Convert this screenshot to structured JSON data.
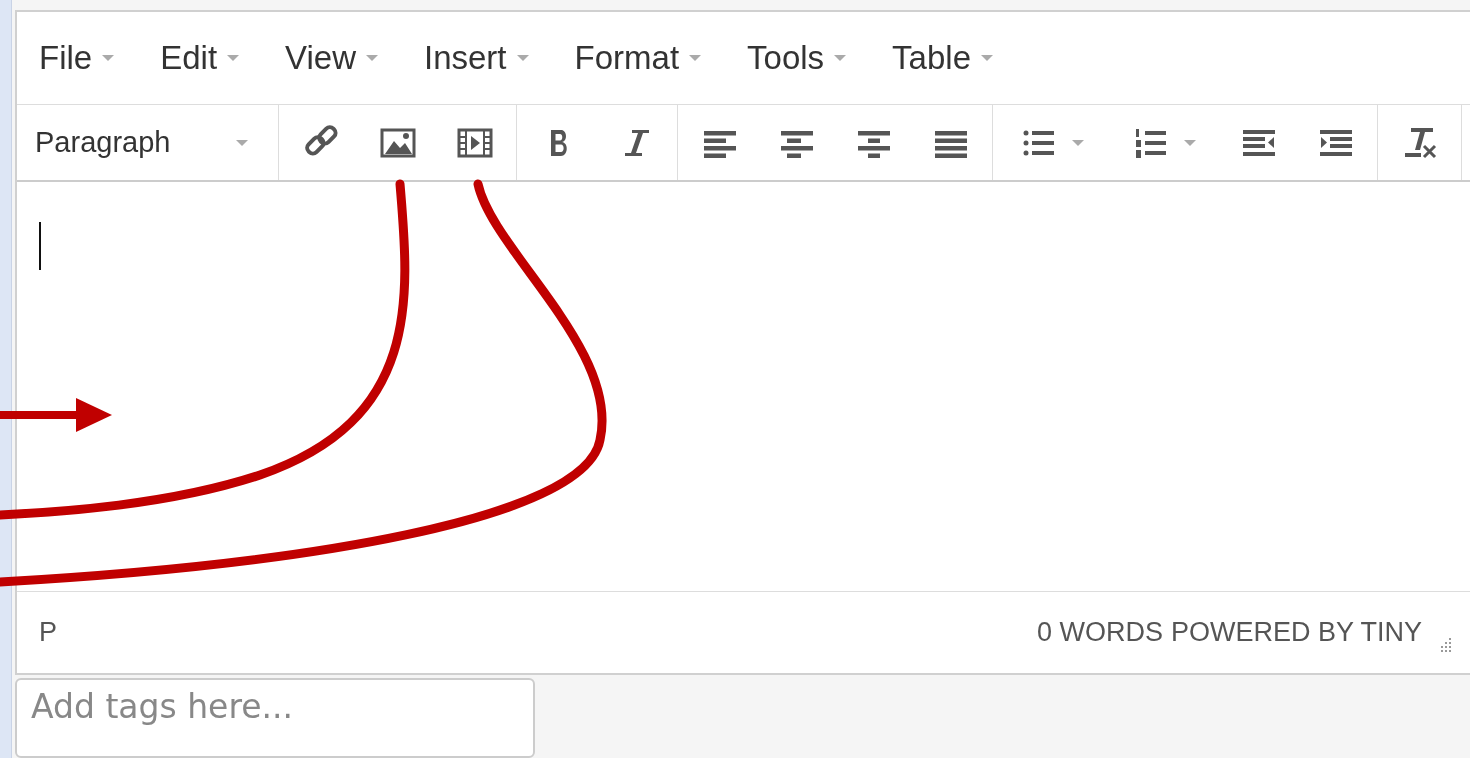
{
  "menubar": [
    {
      "label": "File"
    },
    {
      "label": "Edit"
    },
    {
      "label": "View"
    },
    {
      "label": "Insert"
    },
    {
      "label": "Format"
    },
    {
      "label": "Tools"
    },
    {
      "label": "Table"
    }
  ],
  "toolbar": {
    "format_select": "Paragraph",
    "groups": [
      [
        {
          "kind": "link",
          "has_menu": false
        },
        {
          "kind": "image",
          "has_menu": false
        },
        {
          "kind": "media",
          "has_menu": false
        }
      ],
      [
        {
          "kind": "bold",
          "has_menu": false
        },
        {
          "kind": "italic",
          "has_menu": false
        }
      ],
      [
        {
          "kind": "align-left",
          "has_menu": false
        },
        {
          "kind": "align-center",
          "has_menu": false
        },
        {
          "kind": "align-right",
          "has_menu": false
        },
        {
          "kind": "justify",
          "has_menu": false
        }
      ],
      [
        {
          "kind": "bullet-list",
          "has_menu": true
        },
        {
          "kind": "numbered-list",
          "has_menu": true
        },
        {
          "kind": "outdent",
          "has_menu": false
        },
        {
          "kind": "indent",
          "has_menu": false
        }
      ],
      [
        {
          "kind": "clear-format",
          "has_menu": false
        }
      ]
    ]
  },
  "status_bar": {
    "path": "P",
    "word_count": "0 WORDS",
    "branding": "POWERED BY TINY"
  },
  "tags_field": {
    "placeholder": "Add tags here..."
  },
  "annotations": [
    {
      "kind": "arrow"
    },
    {
      "kind": "curve"
    },
    {
      "kind": "curve"
    }
  ]
}
